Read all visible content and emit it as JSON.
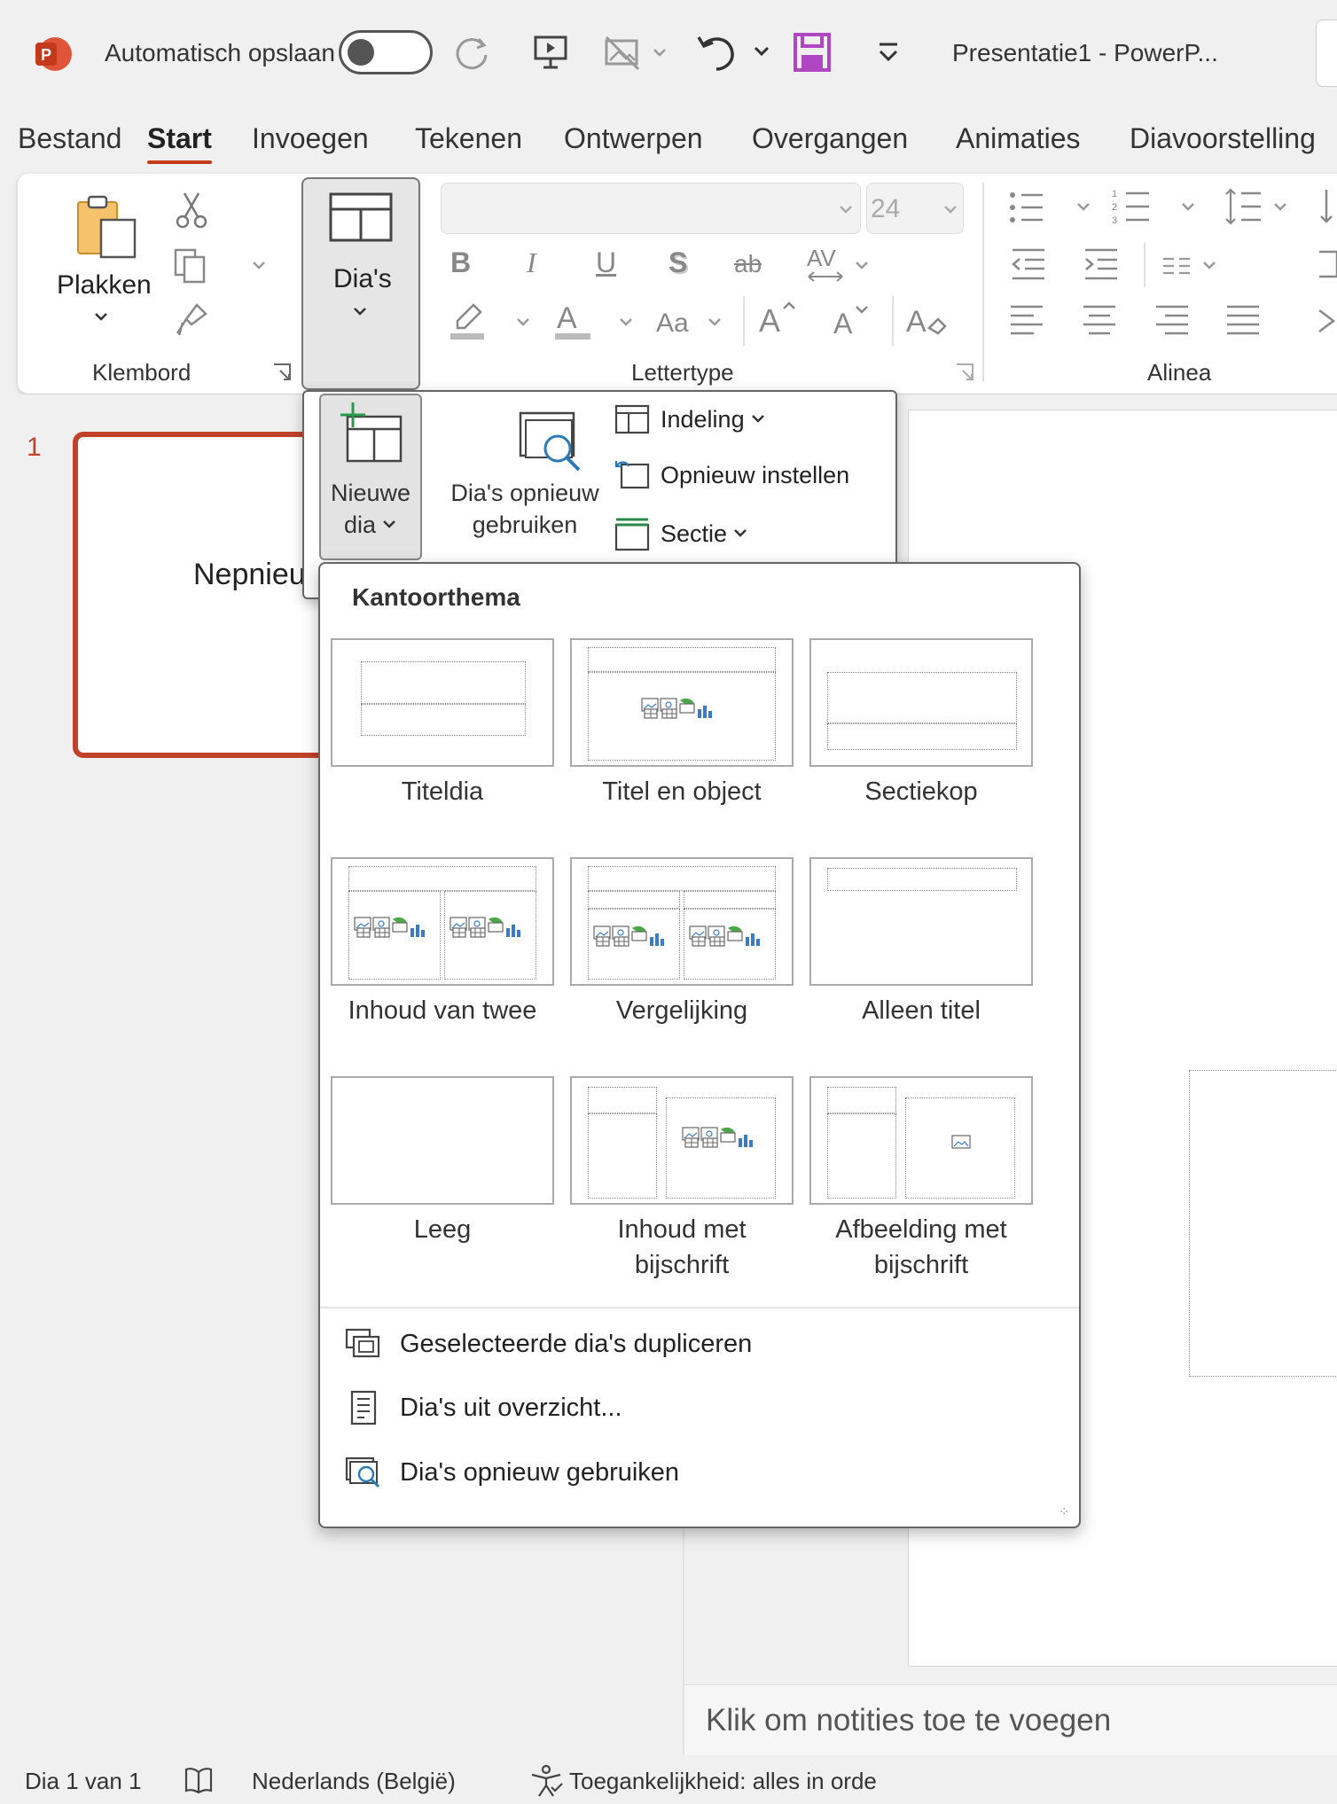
{
  "titlebar": {
    "autosave_label": "Automatisch opslaan",
    "document_title": "Presentatie1  -  PowerP..."
  },
  "tabs": [
    "Bestand",
    "Start",
    "Invoegen",
    "Tekenen",
    "Ontwerpen",
    "Overgangen",
    "Animaties",
    "Diavoorstelling"
  ],
  "ribbon": {
    "paste_label": "Plakken",
    "clipboard_group": "Klembord",
    "slides_label": "Dia's",
    "font_size": "24",
    "case_label": "Aa",
    "font_group": "Lettertype",
    "paragraph_group": "Alinea"
  },
  "flyout": {
    "new_slide_line1": "Nieuwe",
    "new_slide_line2": "dia",
    "reuse_line1": "Dia's opnieuw",
    "reuse_line2": "gebruiken",
    "layout_label": "Indeling",
    "reset_label": "Opnieuw instellen",
    "section_label": "Sectie"
  },
  "gallery": {
    "title": "Kantoorthema",
    "layouts": [
      {
        "line1": "Titeldia",
        "line2": ""
      },
      {
        "line1": "Titel en object",
        "line2": ""
      },
      {
        "line1": "Sectiekop",
        "line2": ""
      },
      {
        "line1": "Inhoud van twee",
        "line2": ""
      },
      {
        "line1": "Vergelijking",
        "line2": ""
      },
      {
        "line1": "Alleen titel",
        "line2": ""
      },
      {
        "line1": "Leeg",
        "line2": ""
      },
      {
        "line1": "Inhoud met",
        "line2": "bijschrift"
      },
      {
        "line1": "Afbeelding met",
        "line2": "bijschrift"
      }
    ],
    "menu": {
      "duplicate": "Geselecteerde dia's dupliceren",
      "outline": "Dia's uit overzicht...",
      "reuse": "Dia's opnieuw gebruiken"
    }
  },
  "slides": {
    "number": "1",
    "thumb_text": "Nepnieuws"
  },
  "notes_placeholder": "Klik om notities toe te voegen",
  "status": {
    "slide_count": "Dia 1 van 1",
    "language": "Nederlands (België)",
    "accessibility": "Toegankelijkheid: alles in orde"
  },
  "colors": {
    "accent": "#c43e1c",
    "save_icon": "#b146c2",
    "thumb_border": "#c0422a"
  }
}
